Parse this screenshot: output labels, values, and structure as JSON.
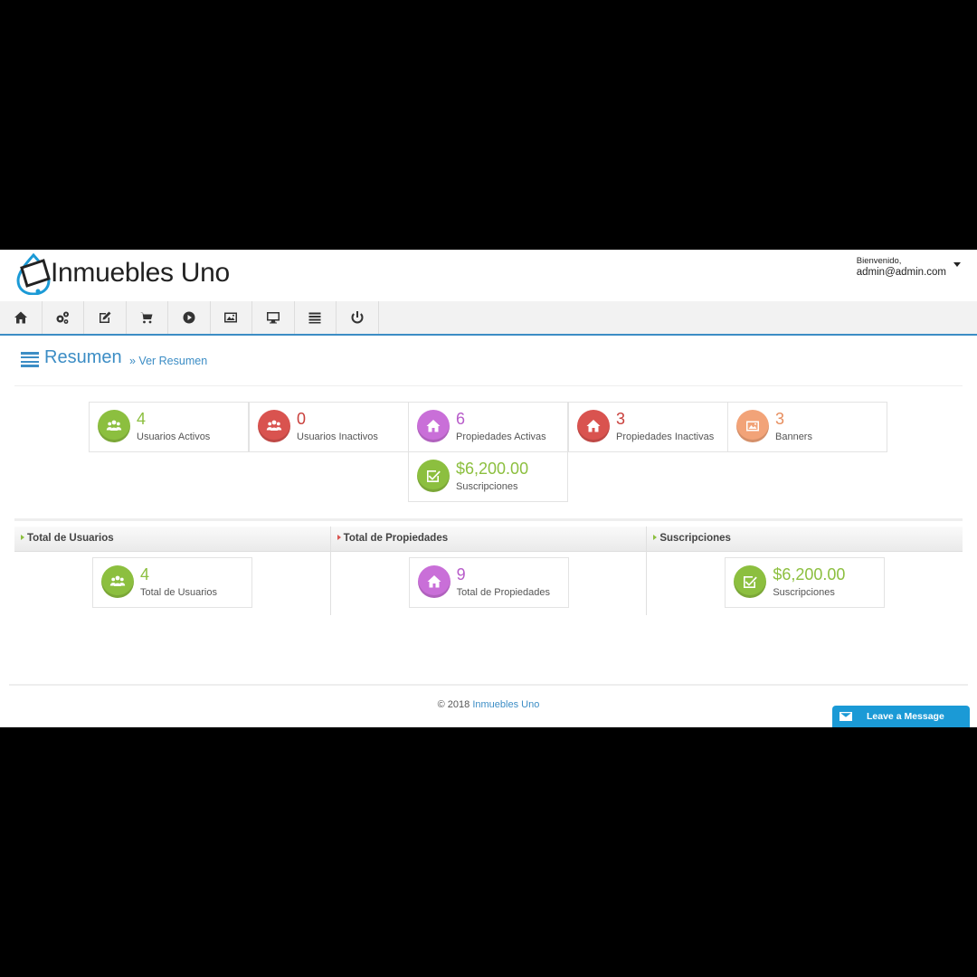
{
  "header": {
    "brand": "Inmuebles Uno",
    "greeting": "Bienvenido,",
    "user_email": "admin@admin.com"
  },
  "toolbar": {
    "icons": [
      "home-icon",
      "gears-icon",
      "edit-icon",
      "cart-icon",
      "play-icon",
      "image-icon",
      "monitor-icon",
      "list-icon",
      "power-icon"
    ]
  },
  "title": {
    "text": "Resumen",
    "link": "» Ver Resumen"
  },
  "stats": [
    {
      "value": "4",
      "label": "Usuarios Activos",
      "icon": "users-icon",
      "color": "#8cbf3f"
    },
    {
      "value": "0",
      "label": "Usuarios Inactivos",
      "icon": "users-icon",
      "color": "#d9534f"
    },
    {
      "value": "6",
      "label": "Propiedades Activas",
      "icon": "home-icon",
      "color": "#c96fd8"
    },
    {
      "value": "3",
      "label": "Propiedades Inactivas",
      "icon": "home-icon",
      "color": "#d9534f"
    },
    {
      "value": "3",
      "label": "Banners",
      "icon": "image-icon",
      "color": "#f2a378"
    },
    {
      "value": "$6,200.00",
      "label": "Suscripciones",
      "icon": "check-icon",
      "color": "#8cbf3f"
    }
  ],
  "summary": [
    {
      "heading": "Total de Usuarios",
      "value": "4",
      "label": "Total de Usuarios",
      "icon": "users-icon",
      "color": "#8cbf3f"
    },
    {
      "heading": "Total de Propiedades",
      "value": "9",
      "label": "Total de Propiedades",
      "icon": "home-icon",
      "color": "#c96fd8"
    },
    {
      "heading": "Suscripciones",
      "value": "$6,200.00",
      "label": "Suscripciones",
      "icon": "check-icon",
      "color": "#8cbf3f"
    }
  ],
  "footer": {
    "copyright": "© 2018",
    "brand": "Inmuebles Uno"
  },
  "chat": {
    "label": "Leave a Message"
  }
}
